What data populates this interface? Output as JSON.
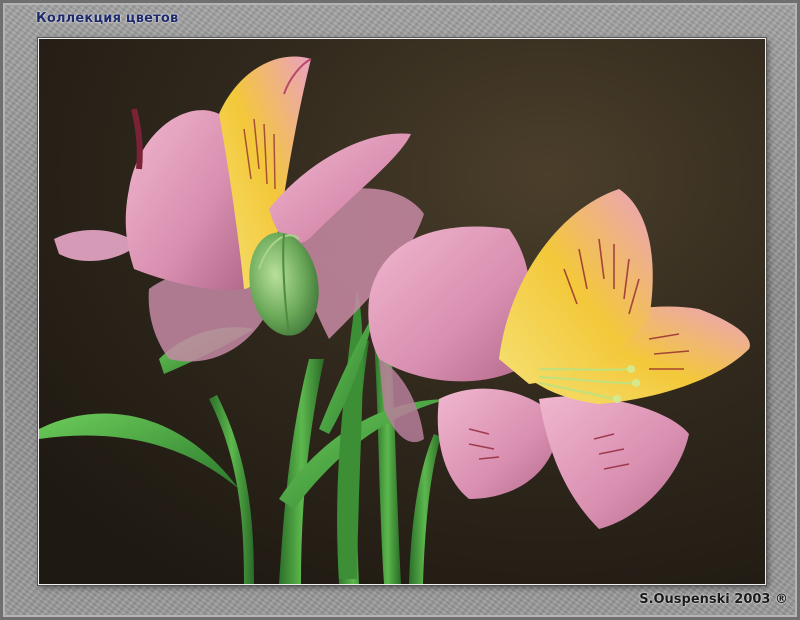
{
  "photo": {
    "title": "Коллекция цветов",
    "credit": "S.Ouspenski 2003 ®",
    "colors": {
      "background": "#2b241a",
      "petal_pink": "#e7a9c3",
      "petal_yellow": "#f3d23a",
      "stem_green": "#3f9a3a",
      "frame_gray": "#9a9a9a",
      "title_color": "#1d2a6b"
    }
  }
}
